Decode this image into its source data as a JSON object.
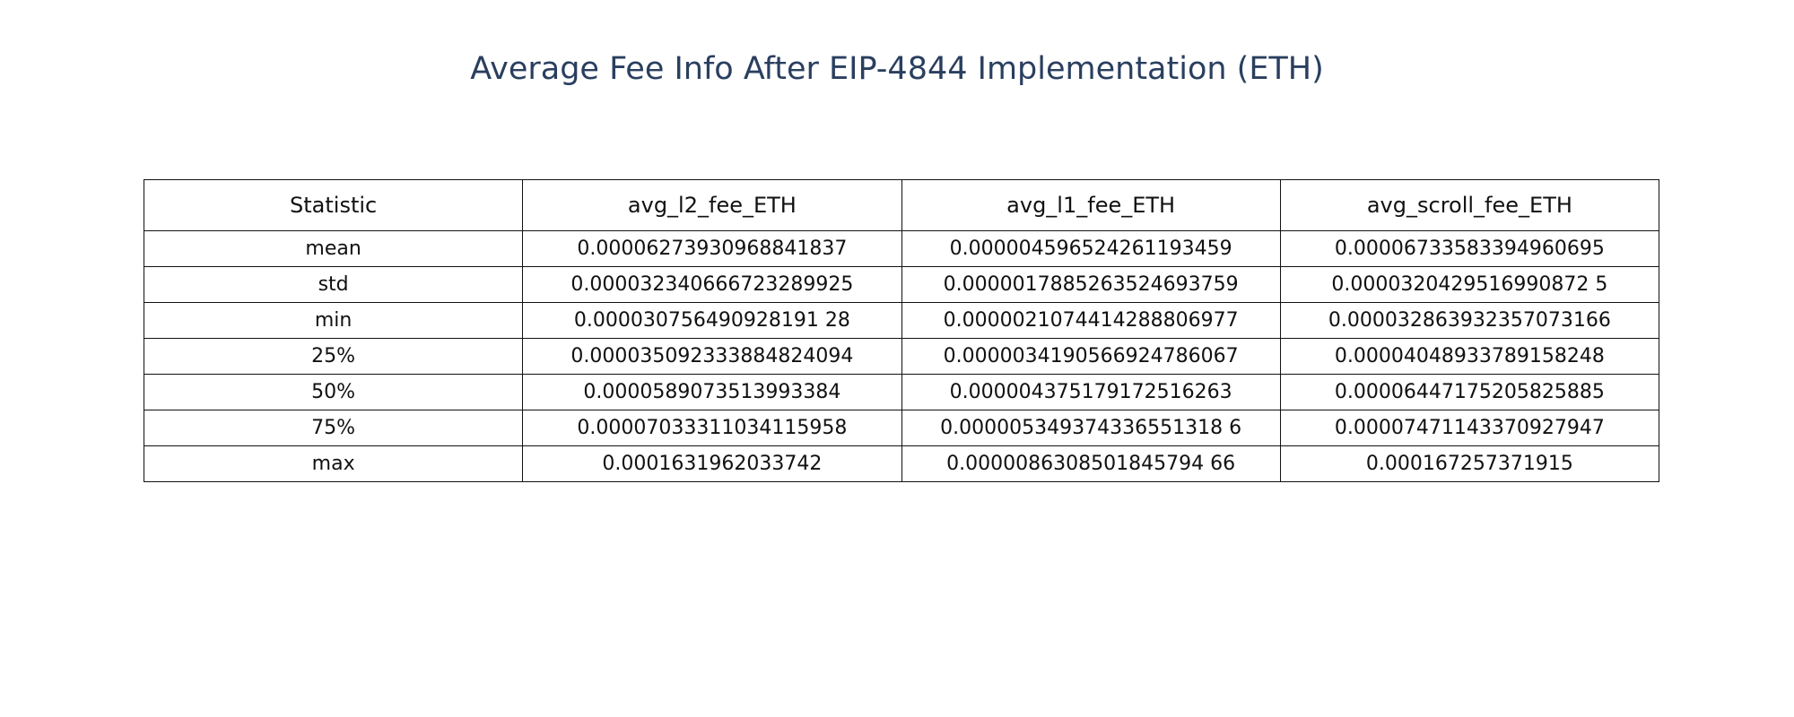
{
  "chart_data": {
    "type": "table",
    "title": "Average Fee Info After EIP-4844 Implementation (ETH)",
    "columns": [
      "Statistic",
      "avg_l2_fee_ETH",
      "avg_l1_fee_ETH",
      "avg_scroll_fee_ETH"
    ],
    "rows": [
      [
        "mean",
        "0.00006273930968841837",
        "0.000004596524261193459",
        "0.00006733583394960695"
      ],
      [
        "std",
        "0.000032340666723289925",
        "0.0000017885263524693759",
        "0.0000320429516990872 5"
      ],
      [
        "min",
        "0.000030756490928191 28",
        "0.0000021074414288806977",
        "0.000032863932357073166"
      ],
      [
        "25%",
        "0.000035092333884824094",
        "0.0000034190566924786067",
        "0.00004048933789158248"
      ],
      [
        "50%",
        "0.0000589073513993384",
        "0.000004375179172516263",
        "0.00006447175205825885"
      ],
      [
        "75%",
        "0.00007033311034115958",
        "0.000005349374336551318 6",
        "0.00007471143370927947"
      ],
      [
        "max",
        "0.0001631962033742",
        "0.0000086308501845794 66",
        "0.000167257371915"
      ]
    ]
  }
}
